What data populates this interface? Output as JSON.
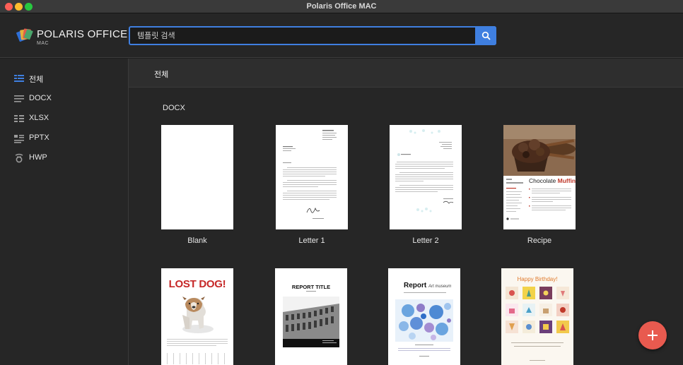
{
  "window": {
    "title": "Polaris Office MAC"
  },
  "logo": {
    "name": "POLARIS OFFICE",
    "sub": "MAC"
  },
  "search": {
    "placeholder": "템플릿 검색",
    "value": ""
  },
  "sidebar": {
    "items": [
      {
        "label": "전체",
        "icon": "all-grid-icon",
        "active": true
      },
      {
        "label": "DOCX",
        "icon": "docx-lines-icon"
      },
      {
        "label": "XLSX",
        "icon": "xlsx-grid-icon"
      },
      {
        "label": "PPTX",
        "icon": "pptx-slides-icon"
      },
      {
        "label": "HWP",
        "icon": "hwp-icon"
      }
    ]
  },
  "main": {
    "tab": "전체",
    "section": "DOCX",
    "templates": [
      {
        "label": "Blank"
      },
      {
        "label": "Letter 1"
      },
      {
        "label": "Letter 2"
      },
      {
        "label": "Recipe",
        "heading": "Chocolate ",
        "heading_bold": "Muffin"
      },
      {
        "label": "",
        "heading": "LOST DOG!"
      },
      {
        "label": "",
        "heading": "REPORT TITLE"
      },
      {
        "label": "",
        "heading": "Report",
        "heading_sub": "Art museum"
      },
      {
        "label": "",
        "heading": "Happy Birthday!"
      }
    ]
  },
  "colors": {
    "accent": "#3f7fe0",
    "fab": "#e85a4f",
    "lost_dog": "#c62828",
    "birthday": "#e07a2c"
  },
  "fab": {
    "icon": "plus-icon"
  }
}
